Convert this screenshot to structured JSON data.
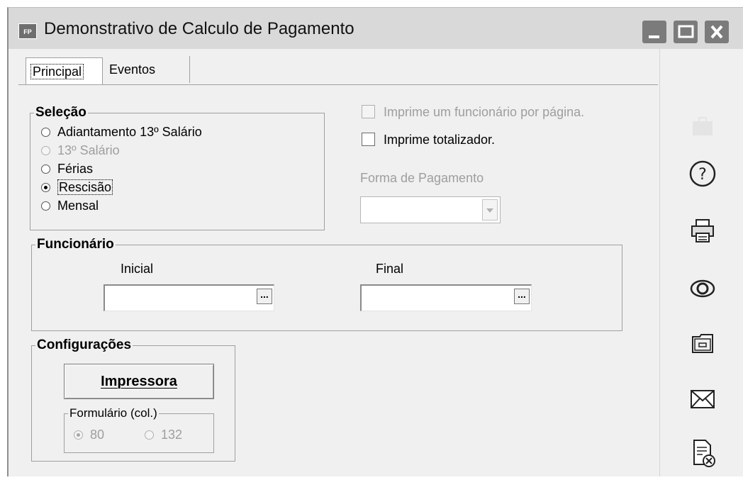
{
  "window": {
    "app_icon_text": "FP",
    "title": "Demonstrativo de Calculo de Pagamento",
    "controls": [
      "minimize-icon",
      "maximize-icon",
      "close-icon"
    ]
  },
  "tabs": [
    {
      "label": "Principal",
      "active": true
    },
    {
      "label": "Eventos",
      "active": false
    }
  ],
  "selecao": {
    "legend": "Seleção",
    "options": [
      {
        "label": "Adiantamento 13º Salário",
        "checked": false,
        "enabled": true
      },
      {
        "label": "13º Salário",
        "checked": false,
        "enabled": false
      },
      {
        "label": "Férias",
        "checked": false,
        "enabled": true
      },
      {
        "label": "Rescisão",
        "checked": true,
        "enabled": true
      },
      {
        "label": "Mensal",
        "checked": false,
        "enabled": true
      }
    ]
  },
  "checkboxes": {
    "one_per_page": {
      "label": "Imprime um funcionário por página.",
      "checked": false,
      "enabled": false
    },
    "totalizador": {
      "label": "Imprime totalizador.",
      "checked": false,
      "enabled": true
    }
  },
  "forma_pagamento": {
    "label": "Forma de Pagamento",
    "value": ""
  },
  "funcionario": {
    "legend": "Funcionário",
    "inicial_label": "Inicial",
    "inicial_value": "",
    "final_label": "Final",
    "final_value": "",
    "lookup_button": "..."
  },
  "configuracoes": {
    "legend": "Configurações",
    "impressora_button": "Impressora",
    "formulario_legend": "Formulário (col.)",
    "formulario_options": [
      {
        "label": "80",
        "checked": true
      },
      {
        "label": "132",
        "checked": false
      }
    ]
  },
  "toolbar_icons": [
    "briefcase-icon",
    "help-icon",
    "printer-icon",
    "eye-icon",
    "archive-icon",
    "mail-icon",
    "document-cancel-icon"
  ],
  "colors": {
    "titlebar": "#d9d9d9",
    "window_controls": "#7b7b7b",
    "face": "#f0f0f0",
    "disabled_text": "#9e9e9e"
  }
}
